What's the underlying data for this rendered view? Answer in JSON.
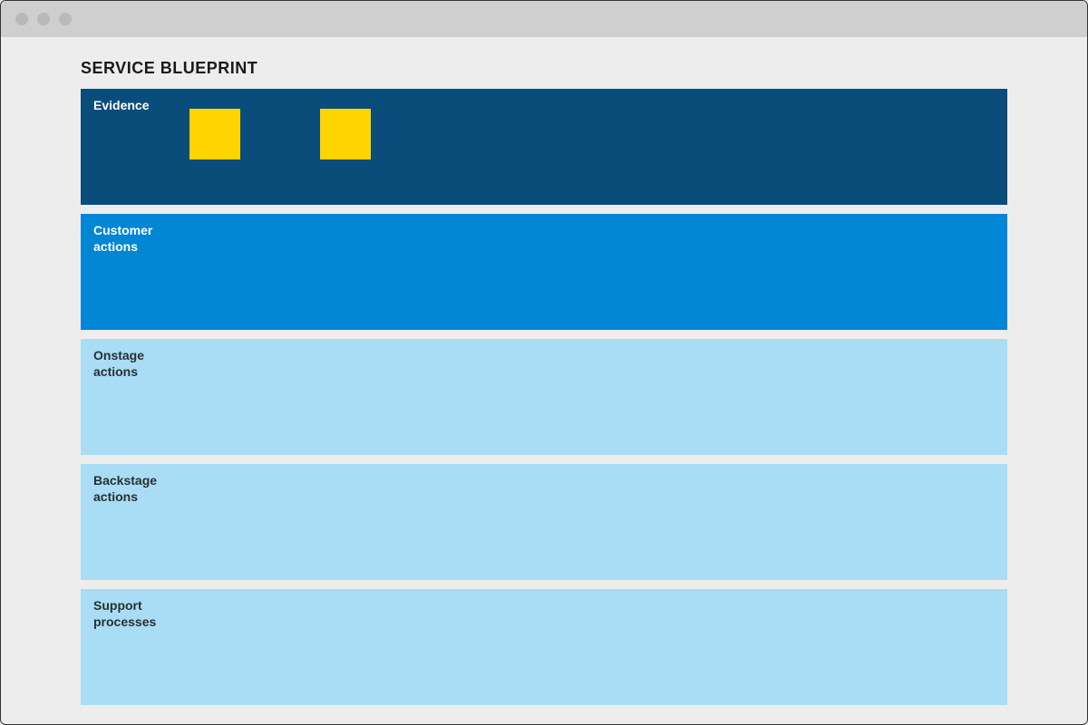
{
  "title": "SERVICE BLUEPRINT",
  "lanes": {
    "evidence": {
      "label": "Evidence"
    },
    "customer": {
      "label": "Customer\nactions"
    },
    "onstage": {
      "label": "Onstage\nactions"
    },
    "backstage": {
      "label": "Backstage\nactions"
    },
    "support": {
      "label": "Support\nprocesses"
    }
  },
  "stickies": {
    "sticky1": "",
    "sticky2": ""
  },
  "colors": {
    "evidence_bg": "#0a4d7a",
    "customer_bg": "#0086d4",
    "light_bg": "#a8ddf5",
    "sticky_bg": "#ffd400",
    "chrome_bg": "#cfcfcf",
    "canvas_bg": "#ededed"
  }
}
